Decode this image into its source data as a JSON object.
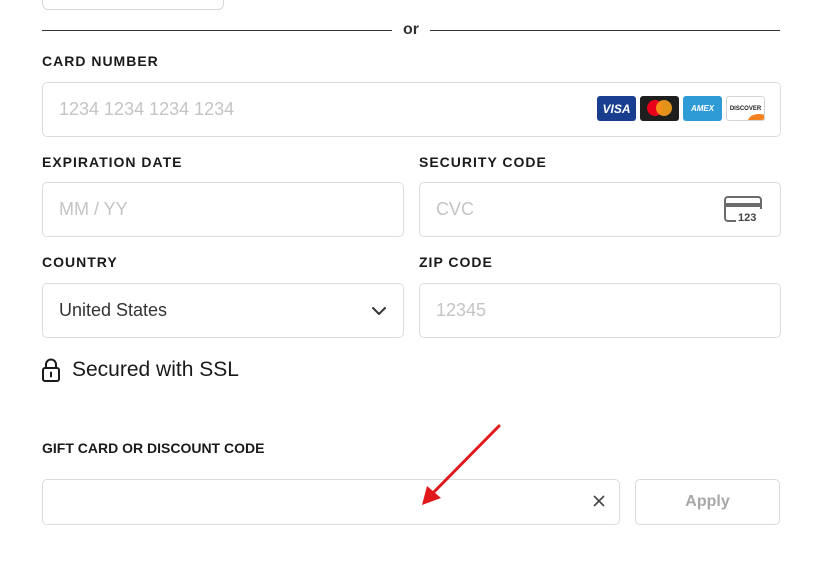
{
  "divider": {
    "text": "or"
  },
  "card_number": {
    "label": "CARD NUMBER",
    "placeholder": "1234 1234 1234 1234",
    "brands": [
      {
        "name": "visa-icon",
        "text": "VISA"
      },
      {
        "name": "mastercard-icon",
        "text": ""
      },
      {
        "name": "amex-icon",
        "text": "AMEX"
      },
      {
        "name": "discover-icon",
        "text": "DISCOVER"
      }
    ]
  },
  "expiration": {
    "label": "EXPIRATION DATE",
    "placeholder": "MM / YY"
  },
  "security_code": {
    "label": "SECURITY CODE",
    "placeholder": "CVC",
    "icon_text": "123",
    "icon": "card-cvc-icon"
  },
  "country": {
    "label": "COUNTRY",
    "value": "United States",
    "icon": "chevron-down-icon"
  },
  "zip": {
    "label": "ZIP CODE",
    "placeholder": "12345"
  },
  "ssl": {
    "text": "Secured with SSL",
    "icon": "lock-icon"
  },
  "gift": {
    "label": "GIFT CARD OR DISCOUNT CODE",
    "value": "",
    "clear_icon": "close-icon",
    "apply_label": "Apply"
  },
  "colors": {
    "annotation_arrow": "#e0181b",
    "visa": "#1a3e8f",
    "amex": "#2e9bd6",
    "mastercard_red": "#eb001b",
    "mastercard_orange": "#f79e1b",
    "discover_orange": "#f58220"
  }
}
